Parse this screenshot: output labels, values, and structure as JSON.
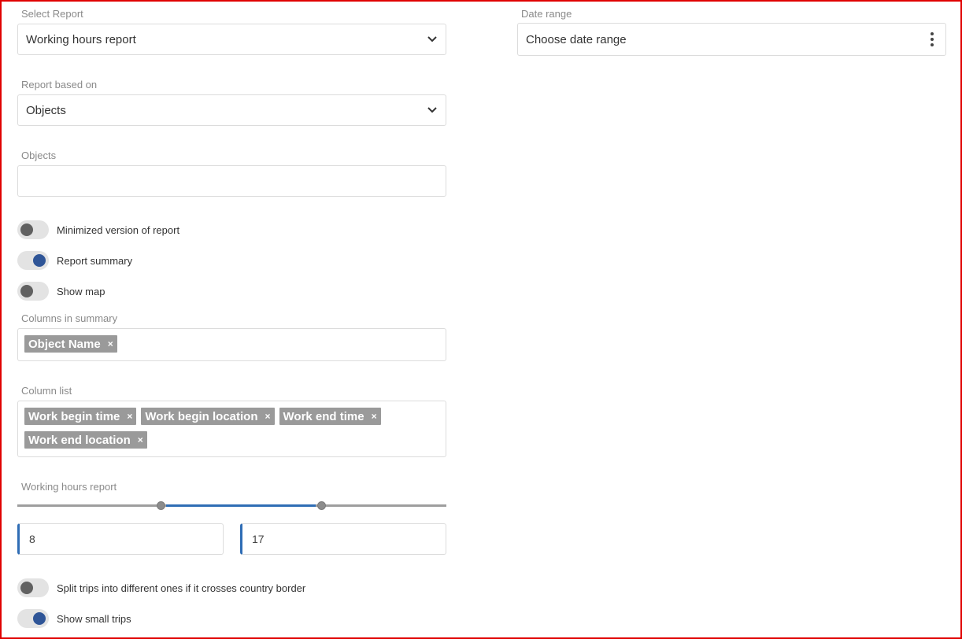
{
  "select_report": {
    "label": "Select Report",
    "value": "Working hours report"
  },
  "date_range": {
    "label": "Date range",
    "value": "Choose date range"
  },
  "report_based_on": {
    "label": "Report based on",
    "value": "Objects"
  },
  "objects": {
    "label": "Objects",
    "value": ""
  },
  "toggles": [
    {
      "label": "Minimized version of report",
      "state": "off"
    },
    {
      "label": "Report summary",
      "state": "on"
    },
    {
      "label": "Show map",
      "state": "off"
    }
  ],
  "columns_in_summary": {
    "label": "Columns in summary",
    "tags": [
      "Object Name"
    ]
  },
  "column_list": {
    "label": "Column list",
    "tags": [
      "Work begin time",
      "Work begin location",
      "Work end time",
      "Work end location"
    ]
  },
  "working_hours": {
    "label": "Working hours report",
    "min": 0,
    "max": 24,
    "start": "8",
    "end": "17"
  },
  "bottom_toggles": [
    {
      "label": "Split trips into different ones if it crosses country border",
      "state": "off"
    },
    {
      "label": "Show small trips",
      "state": "on"
    }
  ],
  "colors": {
    "accent": "#2f6db5",
    "toggle_on": "#2f5597",
    "tag_bg": "#9a9a9a",
    "frame": "#e00000"
  },
  "icons": {
    "remove_tag": "×"
  }
}
